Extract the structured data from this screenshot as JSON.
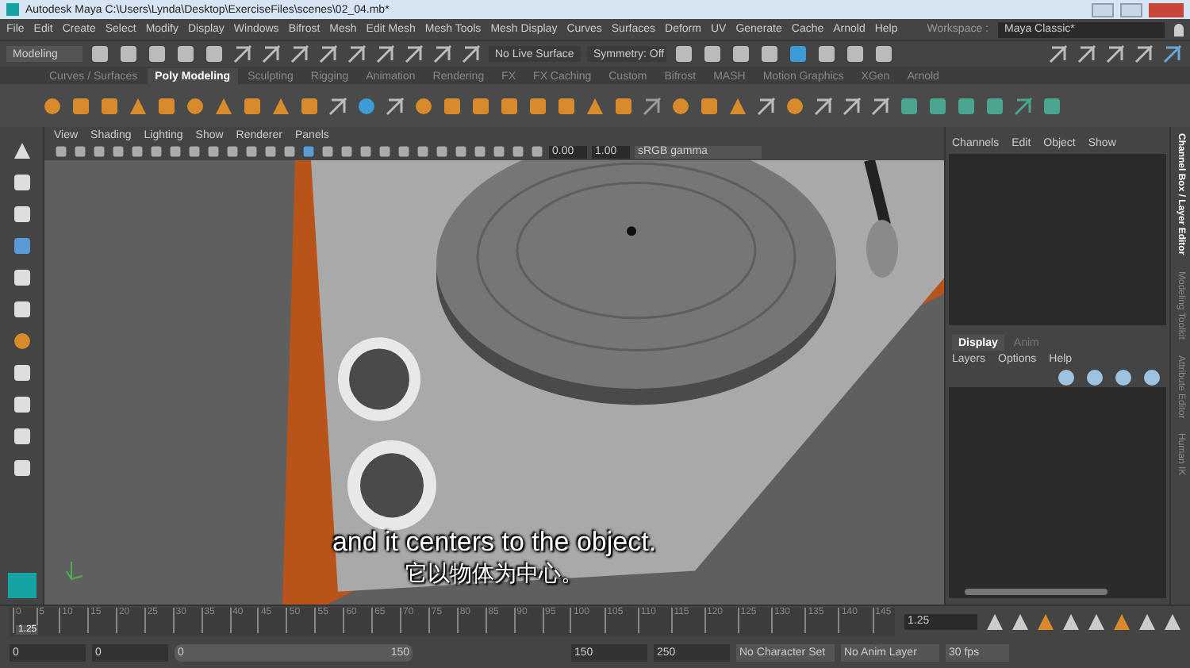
{
  "window": {
    "title": "Autodesk Maya  C:\\Users\\Lynda\\Desktop\\ExerciseFiles\\scenes\\02_04.mb*"
  },
  "menu_bar": [
    "File",
    "Edit",
    "Create",
    "Select",
    "Modify",
    "Display",
    "Windows",
    "Bifrost",
    "Mesh",
    "Edit Mesh",
    "Mesh Tools",
    "Mesh Display",
    "Curves",
    "Surfaces",
    "Deform",
    "UV",
    "Generate",
    "Cache",
    "Arnold",
    "Help"
  ],
  "workspace": {
    "label": "Workspace :",
    "value": "Maya Classic*"
  },
  "status_line": {
    "menu_set": "Modeling",
    "live_surface": "No Live Surface",
    "symmetry": "Symmetry: Off"
  },
  "shelf_tabs": [
    {
      "label": "Curves / Surfaces",
      "selected": false
    },
    {
      "label": "Poly Modeling",
      "selected": true
    },
    {
      "label": "Sculpting",
      "selected": false
    },
    {
      "label": "Rigging",
      "selected": false
    },
    {
      "label": "Animation",
      "selected": false
    },
    {
      "label": "Rendering",
      "selected": false
    },
    {
      "label": "FX",
      "selected": false
    },
    {
      "label": "FX Caching",
      "selected": false
    },
    {
      "label": "Custom",
      "selected": false
    },
    {
      "label": "Bifrost",
      "selected": false
    },
    {
      "label": "MASH",
      "selected": false
    },
    {
      "label": "Motion Graphics",
      "selected": false
    },
    {
      "label": "XGen",
      "selected": false
    },
    {
      "label": "Arnold",
      "selected": false
    }
  ],
  "viewport": {
    "menu": [
      "View",
      "Shading",
      "Lighting",
      "Show",
      "Renderer",
      "Panels"
    ],
    "exposure": "0.00",
    "gamma": "1.00",
    "color_space": "sRGB gamma",
    "captions": [
      "and it centers to the object.",
      "它以物体为中心。"
    ]
  },
  "channel_box": {
    "menu": [
      "Channels",
      "Edit",
      "Object",
      "Show"
    ]
  },
  "layer_editor": {
    "tabs": [
      {
        "label": "Display",
        "selected": true
      },
      {
        "label": "Anim",
        "selected": false
      }
    ],
    "menu": [
      "Layers",
      "Options",
      "Help"
    ]
  },
  "side_tabs": [
    "Channel Box / Layer Editor",
    "Modeling Toolkit",
    "Attribute Editor",
    "Human IK"
  ],
  "time_slider": {
    "ticks": [
      "0",
      "5",
      "10",
      "15",
      "20",
      "25",
      "30",
      "35",
      "40",
      "45",
      "50",
      "55",
      "60",
      "65",
      "70",
      "75",
      "80",
      "85",
      "90",
      "95",
      "100",
      "105",
      "110",
      "115",
      "120",
      "125",
      "130",
      "135",
      "140",
      "145"
    ],
    "current": "1.25",
    "level": 0.008,
    "current_field": "1.25"
  },
  "range_slider": {
    "start": "0",
    "playback_start": "0",
    "range_start": "0",
    "range_end": "150",
    "level": 1,
    "playback_end": "150",
    "end": "250",
    "character_set": "No Character Set",
    "anim_layer": "No Anim Layer",
    "fps": "30 fps"
  }
}
